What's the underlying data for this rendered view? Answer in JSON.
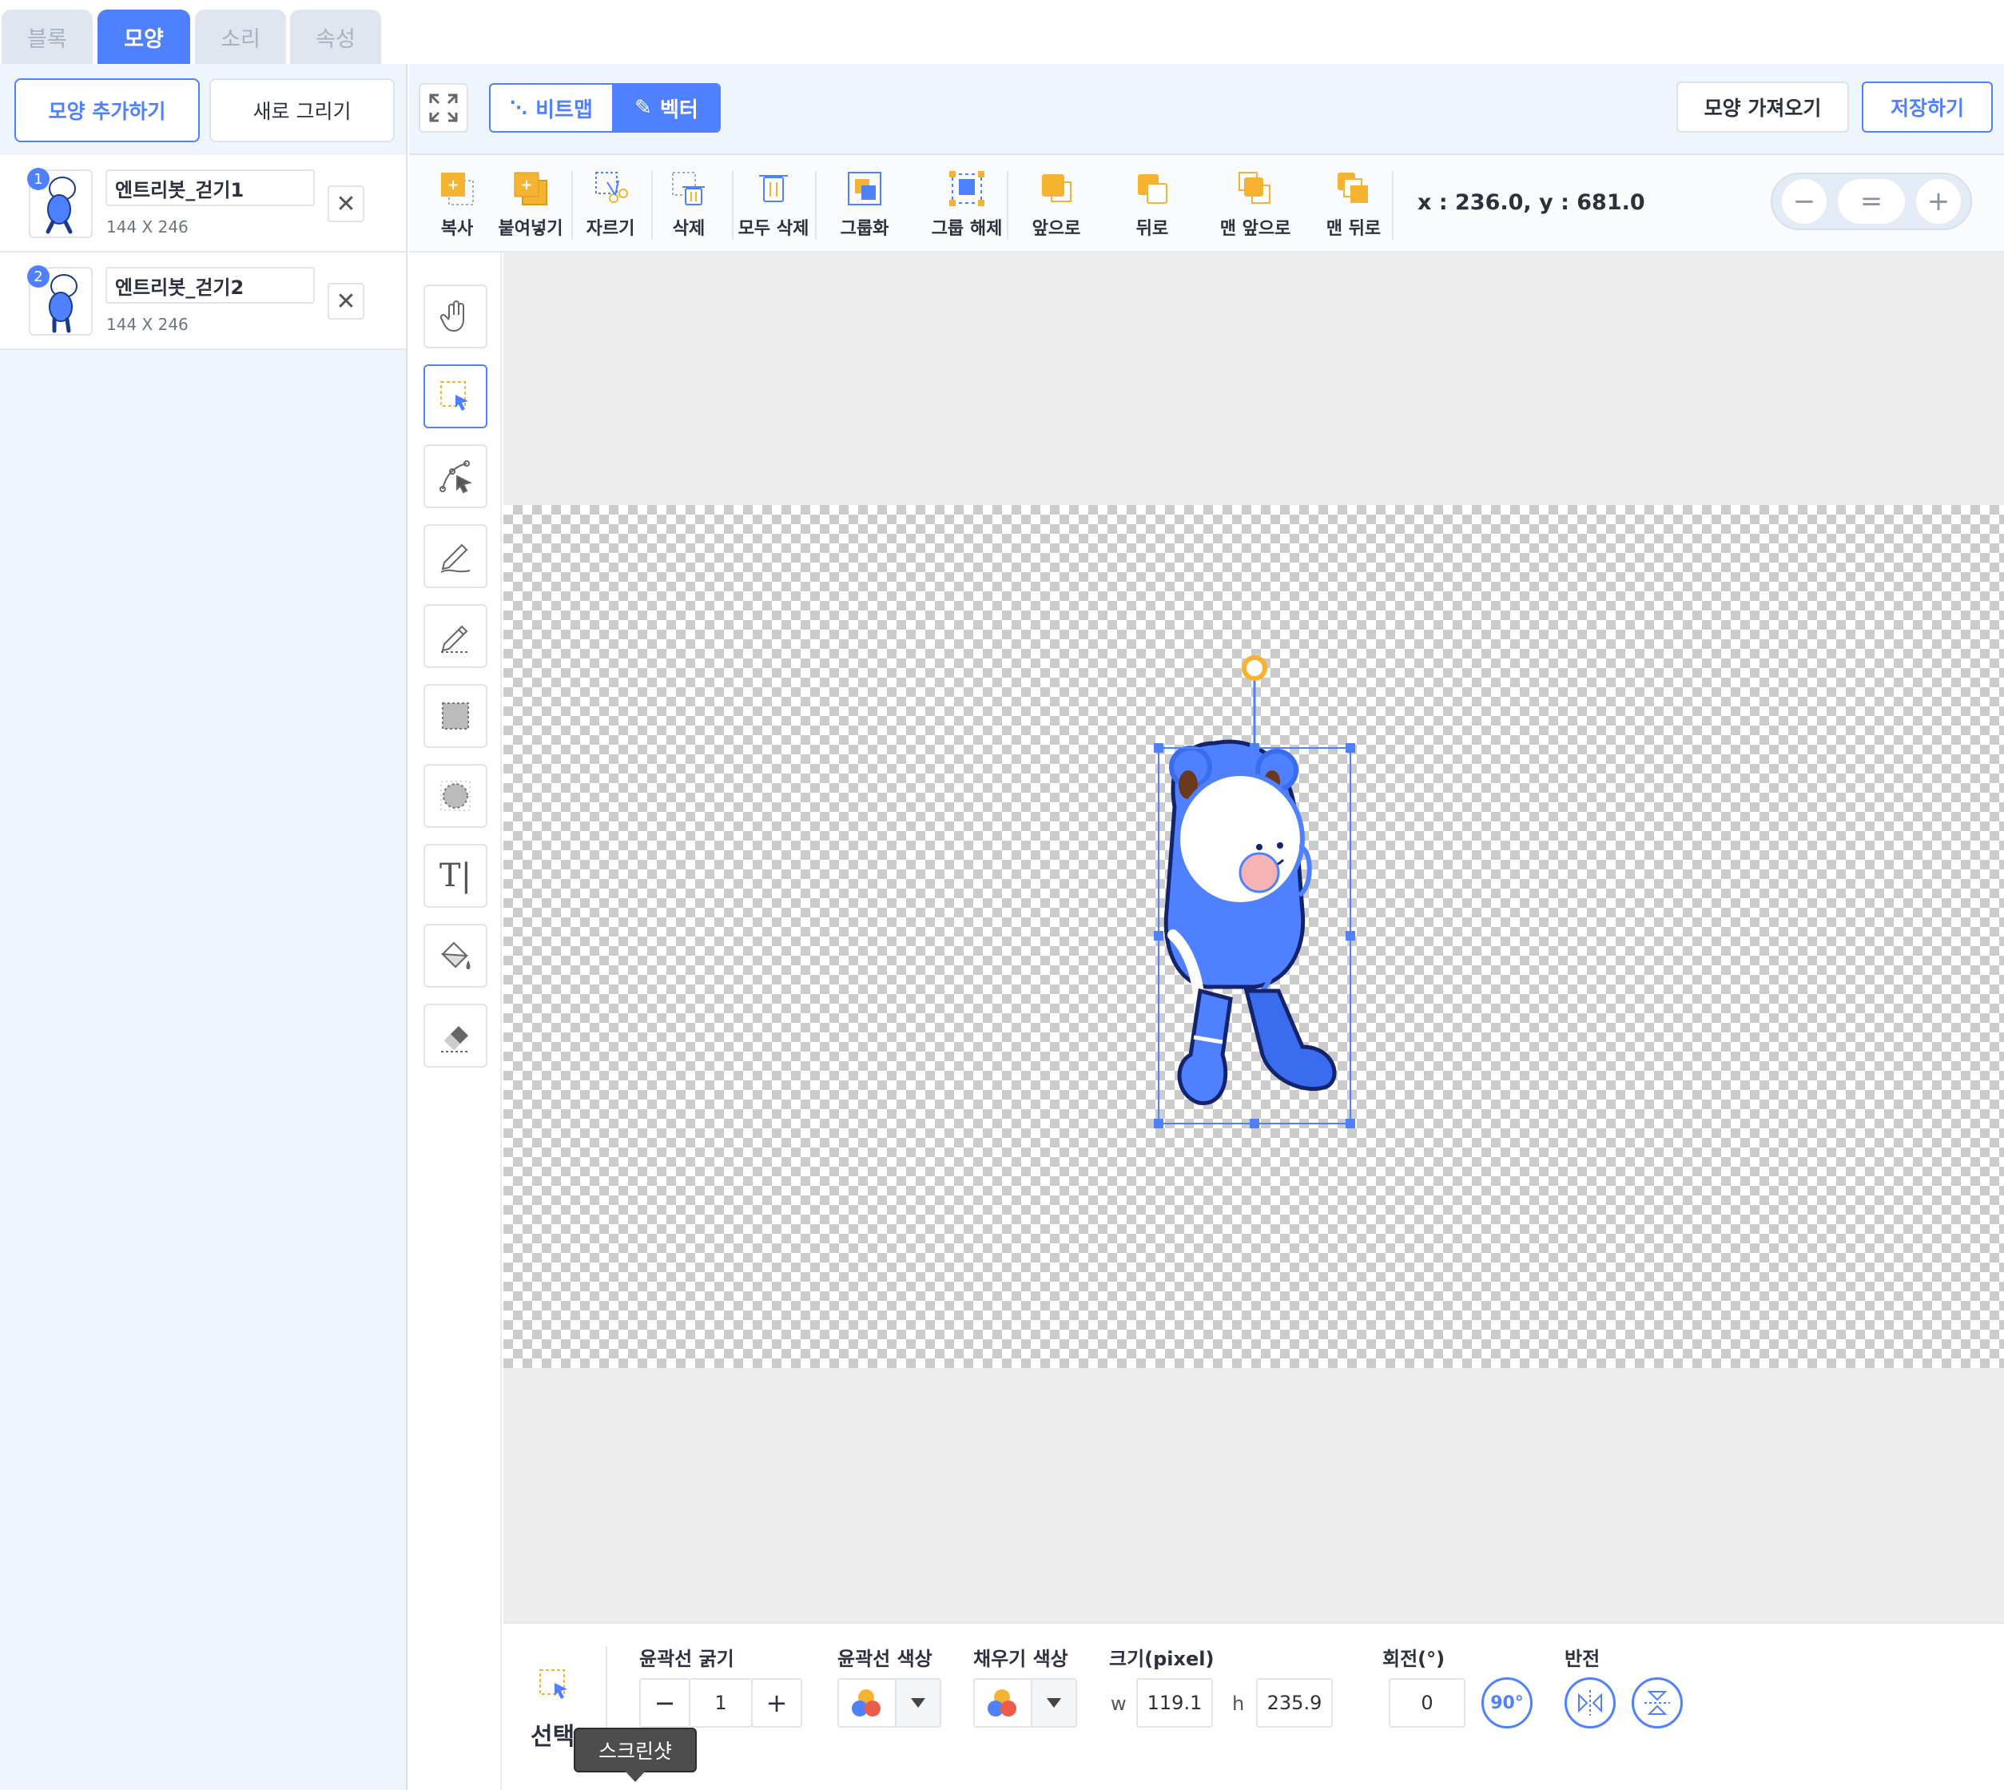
{
  "tabs": [
    {
      "label": "블록",
      "active": false
    },
    {
      "label": "모양",
      "active": true
    },
    {
      "label": "소리",
      "active": false
    },
    {
      "label": "속성",
      "active": false
    }
  ],
  "left_panel": {
    "add_shape_label": "모양 추가하기",
    "new_draw_label": "새로 그리기",
    "costumes": [
      {
        "number": "1",
        "name": "엔트리봇_걷기1",
        "size": "144 X 246"
      },
      {
        "number": "2",
        "name": "엔트리봇_걷기2",
        "size": "144 X 246"
      }
    ]
  },
  "top_bar": {
    "mode_bitmap": "비트맵",
    "mode_vector": "벡터",
    "import_label": "모양 가져오기",
    "save_label": "저장하기"
  },
  "toolbar": {
    "copy": "복사",
    "paste": "붙여넣기",
    "cut": "자르기",
    "delete": "삭제",
    "delete_all": "모두 삭제",
    "group": "그룹화",
    "ungroup": "그룹 해제",
    "forward": "앞으로",
    "backward": "뒤로",
    "to_front": "맨 앞으로",
    "to_back": "맨 뒤로",
    "coords": "x : 236.0, y : 681.0"
  },
  "zoom": {
    "minus": "−",
    "reset": "=",
    "plus": "+"
  },
  "side_tools": [
    "hand-icon",
    "select-icon",
    "path-select-icon",
    "pen-icon",
    "pencil-icon",
    "rectangle-icon",
    "ellipse-icon",
    "text-icon",
    "fill-icon",
    "eraser-icon"
  ],
  "bottom_bar": {
    "tool_name": "선택",
    "stroke_width_label": "윤곽선 굵기",
    "stroke_width_value": "1",
    "stroke_color_label": "윤곽선 색상",
    "fill_color_label": "채우기 색상",
    "size_label": "크기(pixel)",
    "w_label": "w",
    "w_value": "119.1",
    "h_label": "h",
    "h_value": "235.9",
    "rotation_label": "회전(°)",
    "rotation_value": "0",
    "rotate90_label": "90°",
    "flip_label": "반전",
    "minus": "−",
    "plus": "+"
  },
  "tooltip": "스크린샷",
  "colors": {
    "accent": "#4f80ff",
    "tab_inactive": "#dfe6ef",
    "panel_bg": "#eef5fc",
    "canvas_bg": "#ededed",
    "orange": "#f5b331"
  }
}
